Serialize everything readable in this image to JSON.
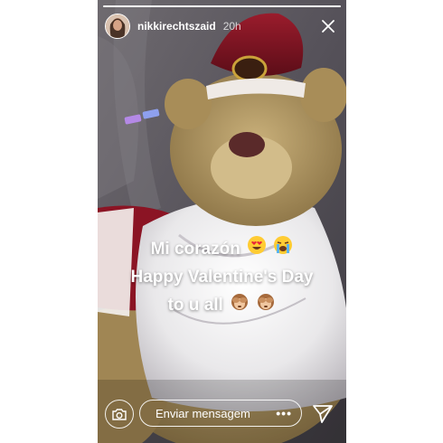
{
  "story": {
    "username": "nikkirechtszaid",
    "time": "20h",
    "progress": 1.0
  },
  "caption": {
    "lines": [
      "Mi corazón",
      "Happy Valentine's Day",
      "to u all"
    ],
    "emojis_line1": [
      "heart-eyes-face",
      "loudly-crying-face"
    ],
    "emojis_line3": [
      "see-no-evil-monkey",
      "see-no-evil-monkey"
    ]
  },
  "footer": {
    "message_placeholder": "Enviar mensagem",
    "more_label": "•••"
  },
  "icons": {
    "close": "close-icon",
    "camera": "camera-icon",
    "send": "send-icon"
  },
  "colors": {
    "caption_text": "#ffffff",
    "text_shadow": "#00000073"
  }
}
